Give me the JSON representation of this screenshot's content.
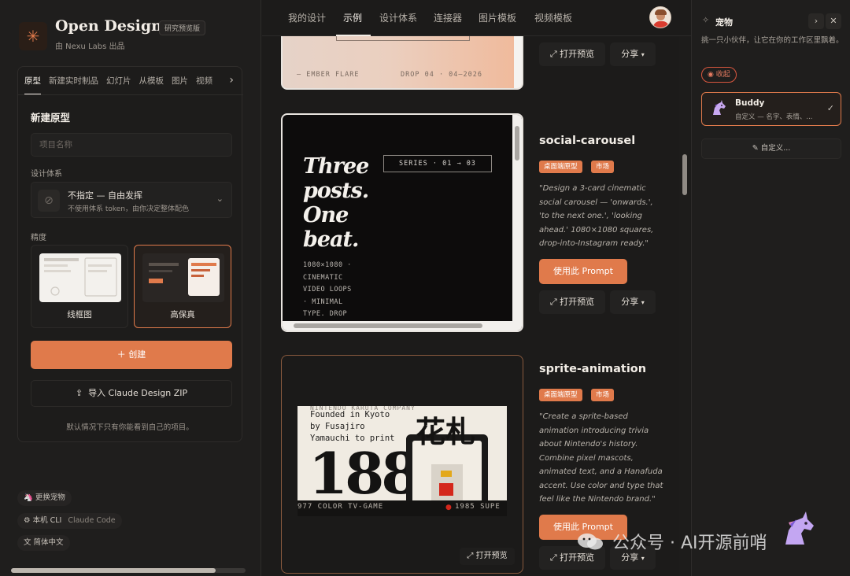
{
  "app": {
    "name": "Open Design",
    "badge": "研究预览版",
    "subtitle": "由 Nexu Labs 出品",
    "logo_glyph": "✳"
  },
  "left": {
    "tabs": [
      "原型",
      "新建实时制品",
      "幻灯片",
      "从模板",
      "图片",
      "视频"
    ],
    "tab_more": "›",
    "section_title": "新建原型",
    "project_name_placeholder": "项目名称",
    "design_system_label": "设计体系",
    "design_system_value": "不指定 — 自由发挥",
    "design_system_hint": "不使用体系 token，由你决定整体配色",
    "fidelity_label": "精度",
    "fidelity_options": [
      "线框图",
      "高保真"
    ],
    "fidelity_selected": "高保真",
    "create_label": "＋ 创建",
    "import_label": "导入 Claude Design ZIP",
    "note": "默认情况下只有你能看到自己的项目。",
    "pet_pill": "更换宠物",
    "cli_pill": "本机 CLI",
    "cli_value": "Claude Code",
    "lang_pill": "简体中文"
  },
  "topnav": {
    "items": [
      "我的设计",
      "示例",
      "设计体系",
      "连接器",
      "图片模板",
      "视频模板"
    ],
    "active": "示例"
  },
  "gallery": {
    "top_card": {
      "footer_left": "— EMBER FLARE",
      "footer_right": "DROP 04 · 04—2026",
      "preview_label": "打开预览",
      "share_label": "分享"
    },
    "cards": [
      {
        "title": "social-carousel",
        "tags": [
          "桌面端原型",
          "市场"
        ],
        "description": "\"Design a 3-card cinematic social carousel — 'onwards.', 'to the next one.', 'looking ahead.' 1080×1080 squares, drop-into-Instagram ready.\"",
        "use_label": "使用此 Prompt",
        "preview_label": "打开预览",
        "share_label": "分享",
        "preview": {
          "headline": [
            "Three",
            "posts.",
            "One",
            "beat."
          ],
          "series": "SERIES · 01 → 03",
          "body": [
            "1080×1080 ·",
            "CINEMATIC",
            "VIDEO LOOPS",
            "· MINIMAL",
            "TYPE. DROP"
          ]
        }
      },
      {
        "title": "sprite-animation",
        "tags": [
          "桌面端原型",
          "市场"
        ],
        "description": "\"Create a sprite-based animation introducing trivia about Nintendo's history. Combine pixel mascots, animated text, and a Hanafuda accent. Use color and type that feel like the Nintendo brand.\"",
        "use_label": "使用此 Prompt",
        "preview_label": "打开预览",
        "share_label": "分享",
        "preview": {
          "lines": [
            "Founded in Kyoto",
            "by Fusajiro",
            "Yamauchi to print"
          ],
          "big_number": "188",
          "footer_left": "977 COLOR TV-GAME",
          "footer_right": "1985 SUPE",
          "overlay_preview": "打开预览"
        }
      }
    ]
  },
  "right": {
    "title": "宠物",
    "description": "挑一只小伙伴，让它在你的工作区里飘着。",
    "collapse_label": "收起",
    "buddy_name": "Buddy",
    "buddy_sub": "自定义 — 名字、表情、...",
    "custom_label": "自定义..."
  },
  "watermark": "公众号 · AI开源前哨",
  "colors": {
    "accent": "#e07a4b",
    "background": "#1c1b1a",
    "panel": "#1f1e1d"
  }
}
